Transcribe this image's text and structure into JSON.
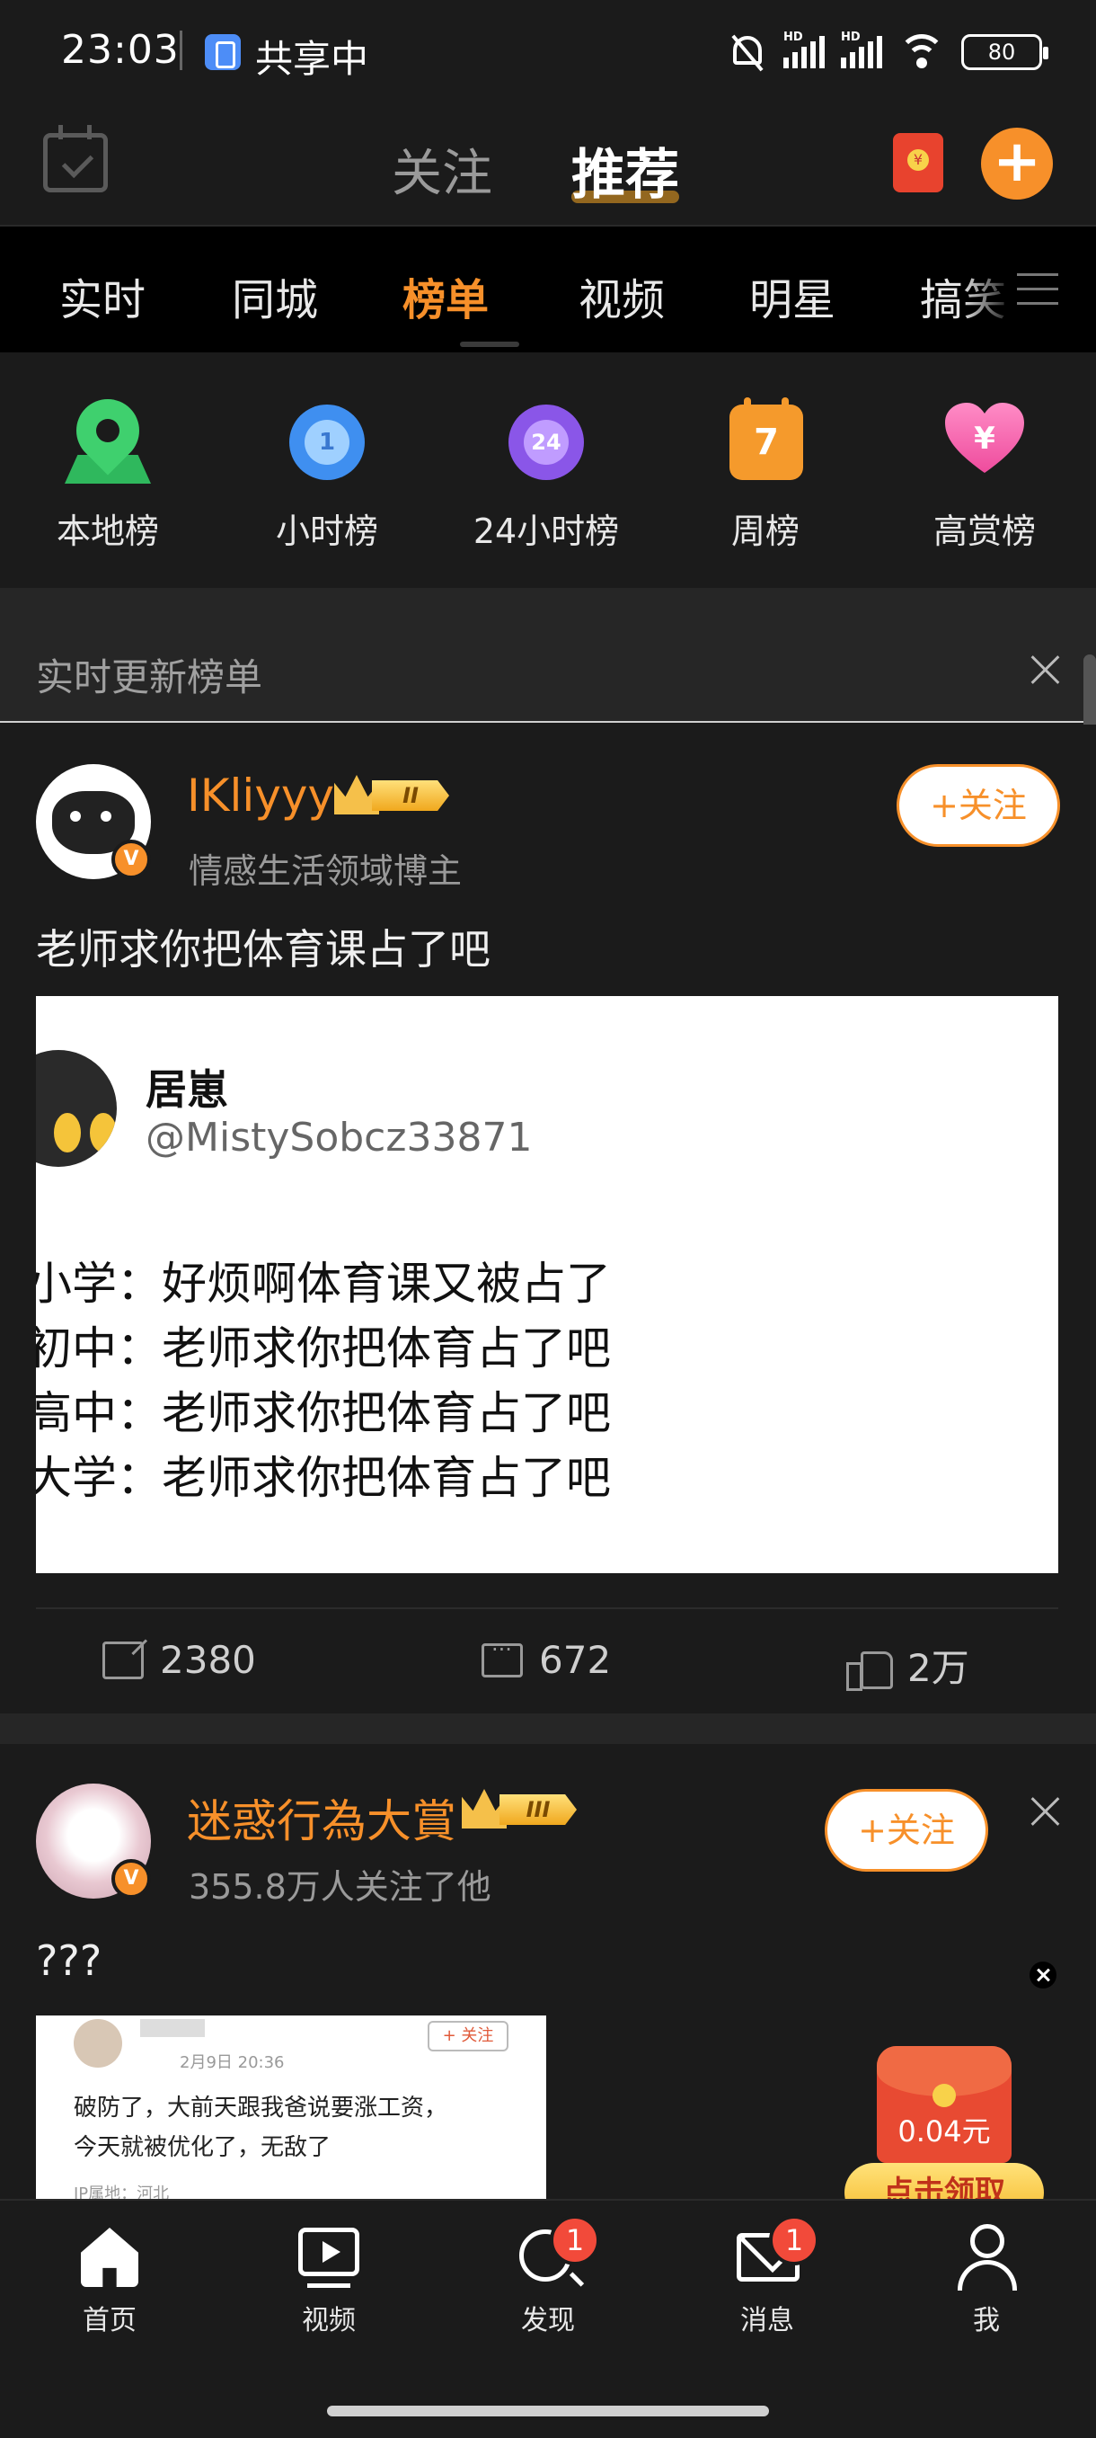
{
  "status_bar": {
    "time": "23:03",
    "share_text": "共享中",
    "battery": "80",
    "hd_label": "HD"
  },
  "top_nav": {
    "tab_follow": "关注",
    "tab_recommend": "推荐",
    "compose": "+",
    "redpacket_symbol": "¥"
  },
  "channels": [
    {
      "label": "实时"
    },
    {
      "label": "同城"
    },
    {
      "label": "榜单",
      "active": true
    },
    {
      "label": "视频"
    },
    {
      "label": "明星"
    },
    {
      "label": "搞笑"
    }
  ],
  "ranks": [
    {
      "label": "本地榜",
      "icon": "location-pin-icon"
    },
    {
      "label": "小时榜",
      "icon": "clock-1-icon",
      "icon_text": "1"
    },
    {
      "label": "24小时榜",
      "icon": "clock-24-icon",
      "icon_text": "24"
    },
    {
      "label": "周榜",
      "icon": "calendar-7-icon",
      "icon_text": "7"
    },
    {
      "label": "高赏榜",
      "icon": "heart-yen-icon",
      "icon_text": "¥"
    }
  ],
  "realtime_header": {
    "title": "实时更新榜单"
  },
  "post1": {
    "username": "IKliyyy",
    "vip_level": "II",
    "subline": "情感生活领域博主",
    "follow_label": "+关注",
    "verified": "V",
    "text": "老师求你把体育课占了吧",
    "image": {
      "name": "居崽",
      "handle": "@MistySobcz33871",
      "lines": [
        "小学：好烦啊体育课又被占了",
        "初中：老师求你把体育占了吧",
        "高中：老师求你把体育占了吧",
        "大学：老师求你把体育占了吧"
      ]
    },
    "actions": {
      "reposts": "2380",
      "comments": "672",
      "likes": "2万"
    }
  },
  "post2": {
    "username": "迷惑行為大賞",
    "vip_level": "III",
    "subline": "355.8万人关注了他",
    "follow_label": "+关注",
    "verified": "V",
    "text": "???",
    "image": {
      "date": "2月9日 20:36",
      "follow": "+ 关注",
      "line1": "破防了，大前天跟我爸说要涨工资，",
      "line2": "今天就被优化了，无敌了",
      "ip": "IP属地：河北"
    }
  },
  "promo": {
    "amount": "0.04元",
    "button": "点击领取"
  },
  "tabbar": [
    {
      "label": "首页",
      "icon": "home-icon"
    },
    {
      "label": "视频",
      "icon": "video-icon"
    },
    {
      "label": "发现",
      "icon": "discover-search-icon",
      "badge": "1"
    },
    {
      "label": "消息",
      "icon": "message-mail-icon",
      "badge": "1"
    },
    {
      "label": "我",
      "icon": "profile-person-icon"
    }
  ],
  "colors": {
    "accent": "#f7902a",
    "background": "#1b1b1b",
    "badge_red": "#f24a3a"
  }
}
